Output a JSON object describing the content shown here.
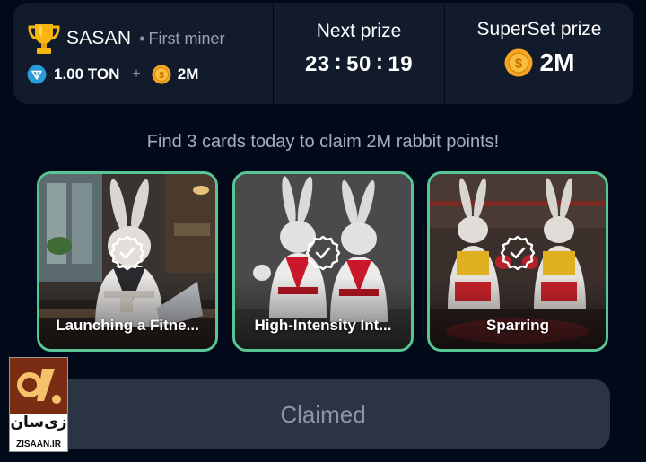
{
  "header": {
    "user": {
      "name": "SASAN",
      "separator": "•",
      "rank": "First miner",
      "ton_balance": "1.00 TON",
      "plus": "+",
      "coins_balance": "2M"
    },
    "next_prize": {
      "label": "Next prize",
      "hours": "23",
      "minutes": "50",
      "seconds": "19",
      "colon": ":"
    },
    "superset_prize": {
      "label": "SuperSet prize",
      "value": "2M"
    }
  },
  "instruction": "Find 3 cards today to claim 2M rabbit points!",
  "cards": [
    {
      "title": "Launching a Fitne...",
      "status_icon": "check-badge-icon",
      "scene": "rabbit-in-cafe-with-laptop"
    },
    {
      "title": "High-Intensity Int...",
      "status_icon": "check-badge-icon",
      "scene": "two-rabbits-karate"
    },
    {
      "title": "Sparring",
      "status_icon": "check-badge-icon",
      "scene": "two-rabbits-sparring-gym"
    }
  ],
  "claim_button": {
    "label": "Claimed"
  },
  "watermark": {
    "fa": "زی‌سان",
    "text": "ZISAAN.IR"
  },
  "colors": {
    "background": "#020a1a",
    "panel": "#111b2b",
    "card_border": "#58c596",
    "button_bg": "#2b3444",
    "button_text": "#8d96a4",
    "muted_text": "#a4aebd",
    "coin": "#f5a623",
    "ton": "#2a9bd9"
  }
}
